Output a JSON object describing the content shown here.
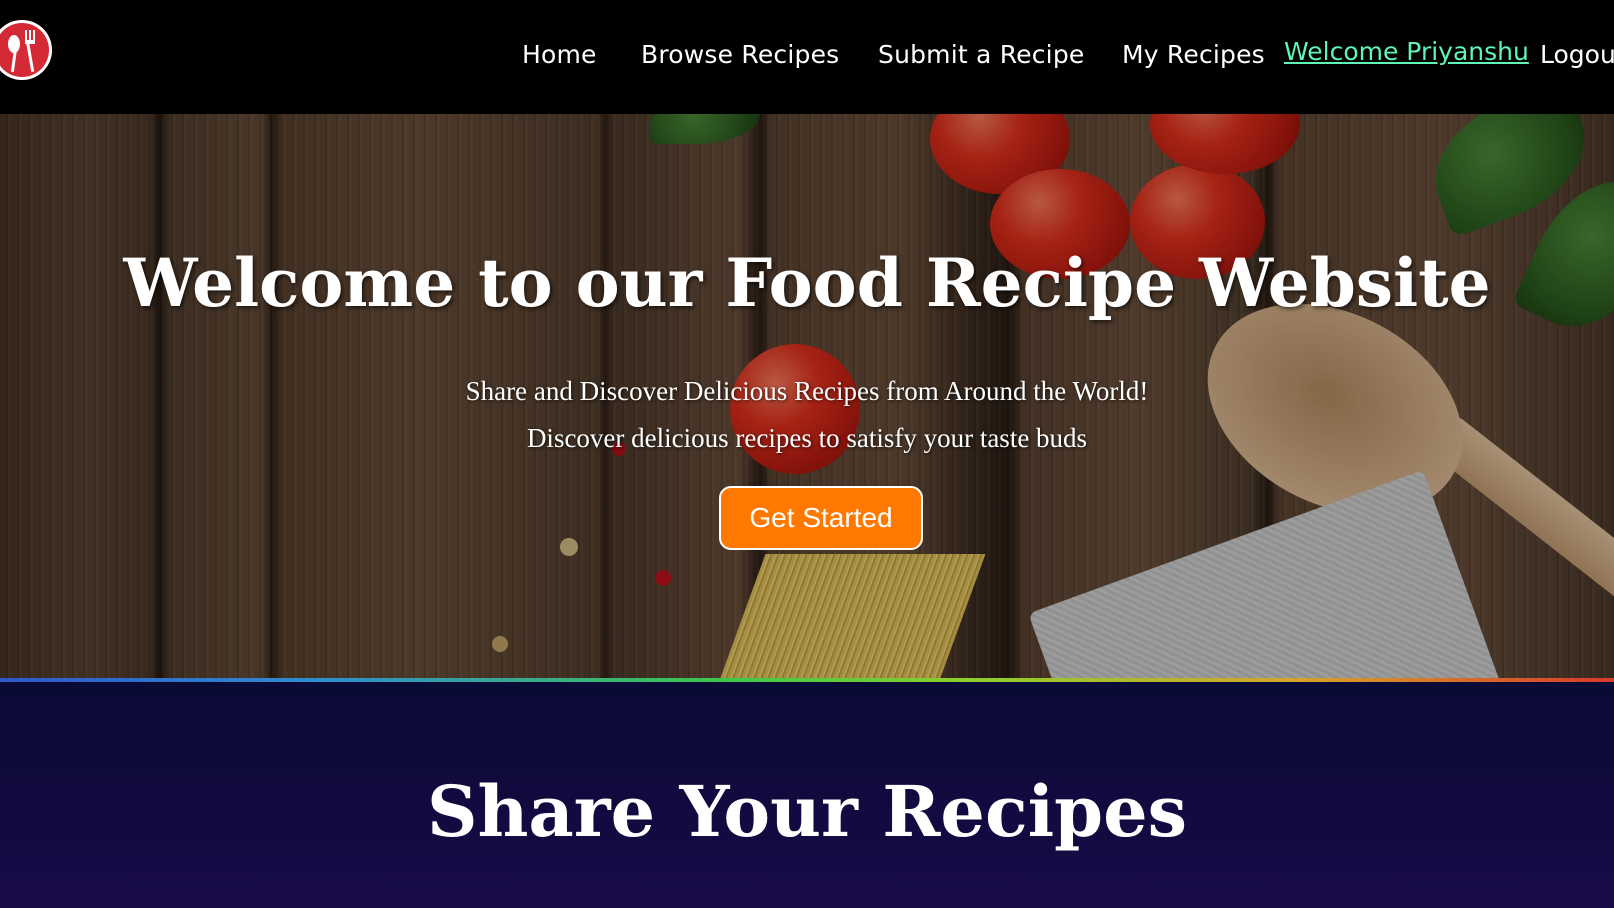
{
  "nav": {
    "items": [
      {
        "label": "Home"
      },
      {
        "label": "Browse Recipes"
      },
      {
        "label": "Submit a Recipe"
      },
      {
        "label": "My Recipes"
      }
    ],
    "welcome": "Welcome Priyanshu",
    "logout": "Logout"
  },
  "hero": {
    "title": "Welcome to our Food Recipe Website",
    "subtitle_1": "Share and Discover Delicious Recipes from Around the World!",
    "subtitle_2": "Discover delicious recipes to satisfy your taste buds",
    "cta_label": "Get Started"
  },
  "section": {
    "title": "Share Your Recipes"
  },
  "colors": {
    "accent": "#ff7800",
    "welcome_link": "#5ff5b5",
    "section_bg": "#0a0a36"
  }
}
